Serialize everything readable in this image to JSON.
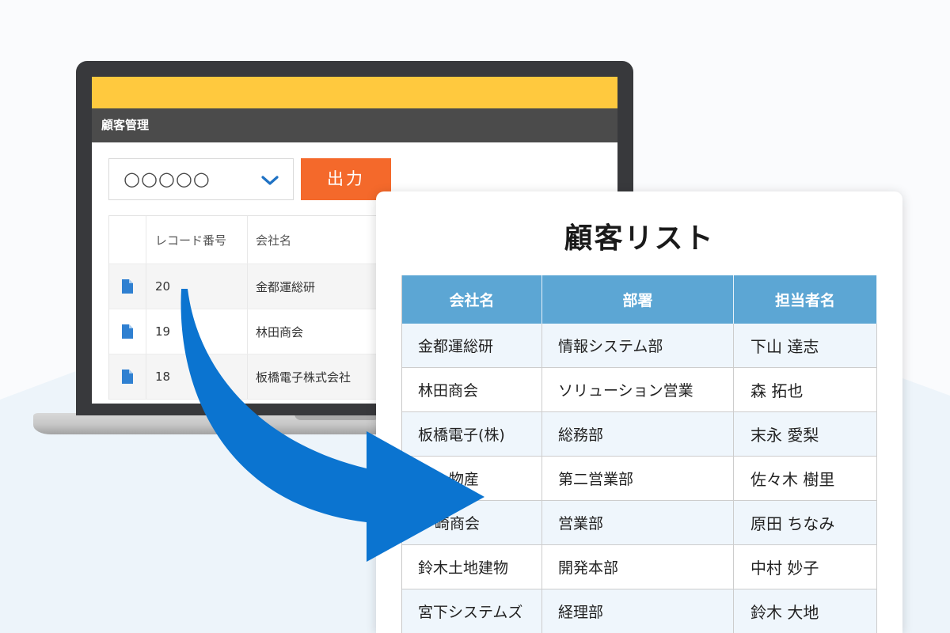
{
  "laptop": {
    "app_title": "顧客管理",
    "view_selector": {
      "value": "○○○○○",
      "icon": "chevron-down-icon"
    },
    "export_button_label": "出力",
    "table": {
      "headers": {
        "record_no": "レコード番号",
        "company": "会社名"
      },
      "row_icon": "document-icon",
      "rows": [
        {
          "record_no": "20",
          "company": "金都運総研"
        },
        {
          "record_no": "19",
          "company": "林田商会"
        },
        {
          "record_no": "18",
          "company": "板橋電子株式会社"
        }
      ]
    }
  },
  "report": {
    "title": "顧客リスト",
    "headers": {
      "company": "会社名",
      "department": "部署",
      "contact": "担当者名"
    },
    "rows": [
      {
        "company": "金都運総研",
        "department": "情報システム部",
        "contact": "下山 達志"
      },
      {
        "company": "林田商会",
        "department": "ソリューション営業",
        "contact": "森 拓也"
      },
      {
        "company": "板橋電子(株)",
        "department": "総務部",
        "contact": "末永 愛梨"
      },
      {
        "company": "物産",
        "department": "第二営業部",
        "contact": "佐々木 樹里"
      },
      {
        "company": "崎商会",
        "department": "営業部",
        "contact": "原田 ちなみ"
      },
      {
        "company": "鈴木土地建物",
        "department": "開発本部",
        "contact": "中村 妙子"
      },
      {
        "company": "宮下システムズ",
        "department": "経理部",
        "contact": "鈴木 大地"
      }
    ]
  },
  "decor": {
    "flow_arrow_icon": "curved-arrow-icon"
  },
  "colors": {
    "header_yellow": "#ffc93e",
    "app_bar": "#4b4b4b",
    "export_button": "#f4692b",
    "report_header": "#5ca6d4",
    "arrow": "#0b74d0",
    "doc_icon": "#2f80d1",
    "chevron": "#1f72c4"
  }
}
